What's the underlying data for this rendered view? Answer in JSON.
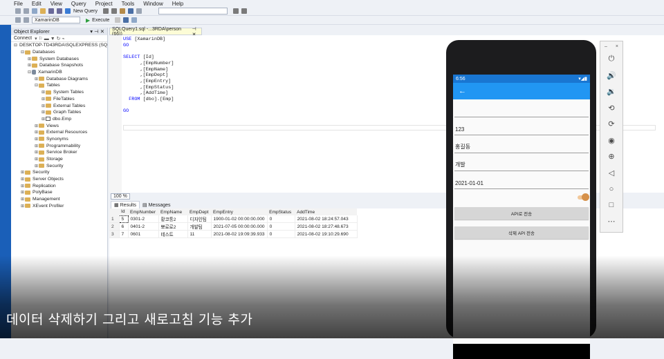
{
  "menu": [
    "File",
    "Edit",
    "View",
    "Query",
    "Project",
    "Tools",
    "Window",
    "Help"
  ],
  "toolbar": {
    "new_query": "New Query",
    "database": "XamarinDB",
    "execute": "Execute"
  },
  "object_explorer": {
    "title": "Object Explorer",
    "connect": "Connect",
    "nodes": [
      {
        "label": "DESKTOP-TD43RDA\\SQLEXPRESS (SQ",
        "indent": 0,
        "exp": "⊟",
        "icon": "server"
      },
      {
        "label": "Databases",
        "indent": 1,
        "exp": "⊟",
        "icon": "folder"
      },
      {
        "label": "System Databases",
        "indent": 2,
        "exp": "⊞",
        "icon": "folder"
      },
      {
        "label": "Database Snapshots",
        "indent": 2,
        "exp": "⊞",
        "icon": "folder"
      },
      {
        "label": "XamarinDB",
        "indent": 2,
        "exp": "⊟",
        "icon": "db"
      },
      {
        "label": "Database Diagrams",
        "indent": 3,
        "exp": "⊞",
        "icon": "folder"
      },
      {
        "label": "Tables",
        "indent": 3,
        "exp": "⊟",
        "icon": "folder"
      },
      {
        "label": "System Tables",
        "indent": 4,
        "exp": "⊞",
        "icon": "folder"
      },
      {
        "label": "FileTables",
        "indent": 4,
        "exp": "⊞",
        "icon": "folder"
      },
      {
        "label": "External Tables",
        "indent": 4,
        "exp": "⊞",
        "icon": "folder"
      },
      {
        "label": "Graph Tables",
        "indent": 4,
        "exp": "⊞",
        "icon": "folder"
      },
      {
        "label": "dbo.Emp",
        "indent": 4,
        "exp": "⊞",
        "icon": "table"
      },
      {
        "label": "Views",
        "indent": 3,
        "exp": "⊞",
        "icon": "folder"
      },
      {
        "label": "External Resources",
        "indent": 3,
        "exp": "⊞",
        "icon": "folder"
      },
      {
        "label": "Synonyms",
        "indent": 3,
        "exp": "⊞",
        "icon": "folder"
      },
      {
        "label": "Programmability",
        "indent": 3,
        "exp": "⊞",
        "icon": "folder"
      },
      {
        "label": "Service Broker",
        "indent": 3,
        "exp": "⊞",
        "icon": "folder"
      },
      {
        "label": "Storage",
        "indent": 3,
        "exp": "⊞",
        "icon": "folder"
      },
      {
        "label": "Security",
        "indent": 3,
        "exp": "⊞",
        "icon": "folder"
      },
      {
        "label": "Security",
        "indent": 1,
        "exp": "⊞",
        "icon": "folder"
      },
      {
        "label": "Server Objects",
        "indent": 1,
        "exp": "⊞",
        "icon": "folder"
      },
      {
        "label": "Replication",
        "indent": 1,
        "exp": "⊞",
        "icon": "folder"
      },
      {
        "label": "PolyBase",
        "indent": 1,
        "exp": "⊞",
        "icon": "folder"
      },
      {
        "label": "Management",
        "indent": 1,
        "exp": "⊞",
        "icon": "folder"
      },
      {
        "label": "XEvent Profiler",
        "indent": 1,
        "exp": "⊞",
        "icon": "folder"
      }
    ]
  },
  "editor": {
    "tab_label": "SQLQuery1.sql -...3RDA\\person (66))",
    "code": "USE [XamarinDB]\nGO\n\nSELECT [Id]\n      ,[EmpNumber]\n      ,[EmpName]\n      ,[EmpDept]\n      ,[EmpEntry]\n      ,[EmpStatus]\n      ,[AddTime]\n  FROM [dbo].[Emp]\n\nGO"
  },
  "zoom": "100 %",
  "results": {
    "tabs": [
      "Results",
      "Messages"
    ],
    "columns": [
      "Id",
      "EmpNumber",
      "EmpName",
      "EmpDept",
      "EmpEntry",
      "EmpStatus",
      "AddTime"
    ],
    "rows": [
      [
        "1",
        "5",
        "0301-2",
        "황코퉁2",
        "디자인팀",
        "1900-01-02 00:00:00.000",
        "0",
        "2021-08-02 18:24:57.043"
      ],
      [
        "2",
        "6",
        "0401-2",
        "뽀로로2",
        "개발팀",
        "2021-07-05 00:00:00.000",
        "0",
        "2021-08-02 18:27:48.673"
      ],
      [
        "3",
        "7",
        "0601",
        "테스트",
        "11",
        "2021-08-02 19:09:39.933",
        "0",
        "2021-08-02 19:10:29.690"
      ]
    ]
  },
  "phone": {
    "time": "6:56",
    "fields": [
      "",
      "123",
      "홍길동",
      "개발",
      "2021-01-01"
    ],
    "btn_send": "API로 전송",
    "btn_delete": "삭제 API 전송"
  },
  "caption": "데이터 삭제하기 그리고 새로고침 기능 추가",
  "colors": {
    "accent": "#2196f3",
    "status": "#1976d2",
    "taskbar": "#1a5fb8"
  }
}
